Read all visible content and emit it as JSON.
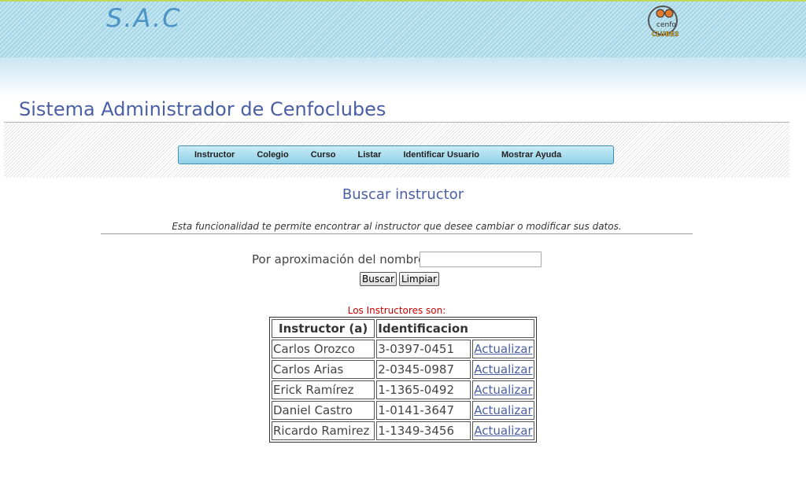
{
  "header": {
    "brand": "S.A.C",
    "logo_text_top": "cenfo",
    "logo_text_bottom": "CLUBES"
  },
  "page_title": "Sistema Administrador de Cenfoclubes",
  "nav": {
    "items": [
      "Instructor",
      "Colegio",
      "Curso",
      "Listar",
      "Identificar Usuario",
      "Mostrar Ayuda"
    ]
  },
  "section": {
    "title": "Buscar instructor",
    "description": "Esta funcionalidad te permite encontrar al instructor que desee cambiar o modificar sus datos."
  },
  "search": {
    "label": "Por aproximación del nombre",
    "value": "",
    "search_button": "Buscar",
    "clear_button": "Limpiar"
  },
  "results": {
    "label": "Los Instructores son:",
    "columns": [
      "Instructor (a)",
      "Identificacion"
    ],
    "rows": [
      {
        "name": "Carlos Orozco",
        "id": "3-0397-0451",
        "action": "Actualizar"
      },
      {
        "name": "Carlos Arias",
        "id": "2-0345-0987",
        "action": "Actualizar"
      },
      {
        "name": "Erick Ramírez",
        "id": "1-1365-0492",
        "action": "Actualizar"
      },
      {
        "name": "Daniel Castro",
        "id": "1-0141-3647",
        "action": "Actualizar"
      },
      {
        "name": "Ricardo Ramirez",
        "id": "1-1349-3456",
        "action": "Actualizar"
      }
    ]
  },
  "colors": {
    "title_blue": "#4a5fa4",
    "banner_cyan": "#a9d9e8",
    "result_label_red": "#cc0000"
  }
}
